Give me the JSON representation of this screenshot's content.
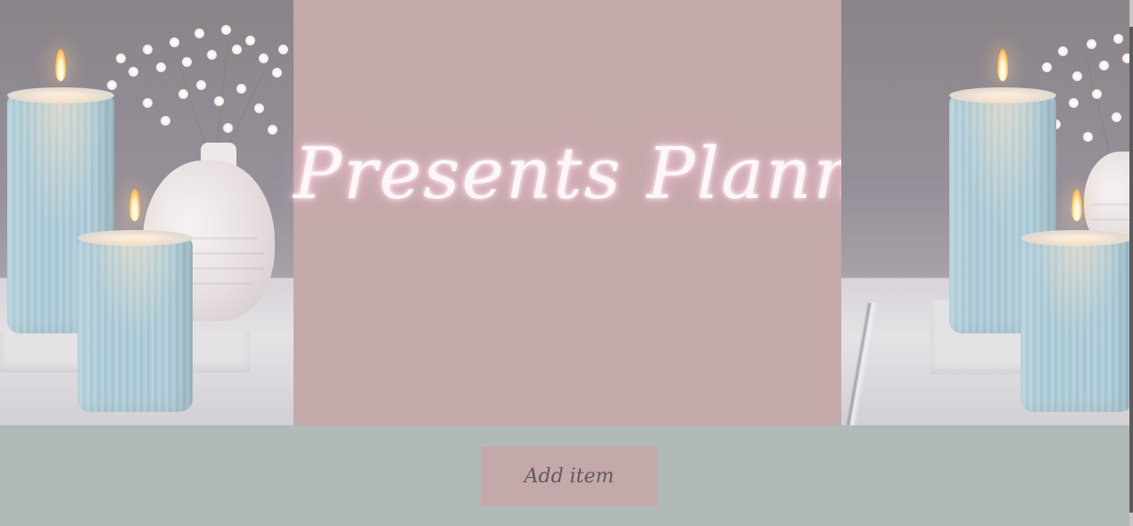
{
  "header": {
    "title": "Presents Planner"
  },
  "actions": {
    "add_item_label": "Add item"
  },
  "images": {
    "left": "candles-and-vase-photo",
    "right": "candles-and-vase-photo"
  },
  "colors": {
    "panel": "#c4a9ab",
    "footer": "#b2b9b9",
    "title_glow": "#fff6fa",
    "button_text": "#5f5a60"
  }
}
